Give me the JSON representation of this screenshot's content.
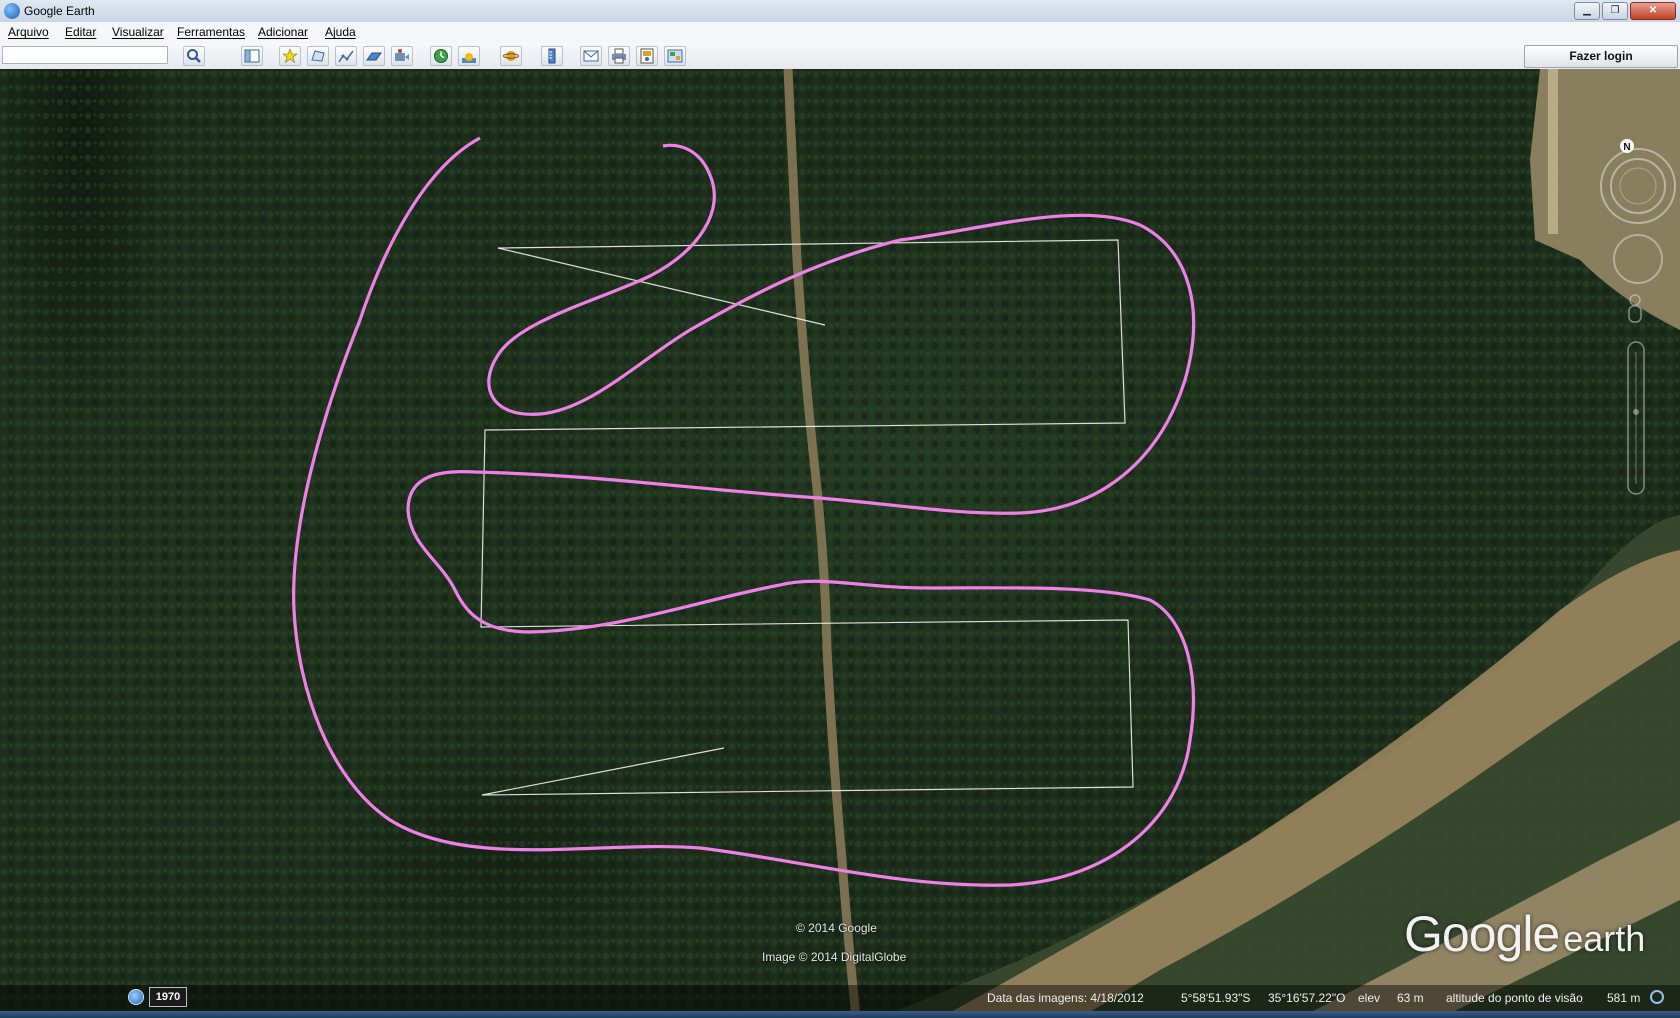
{
  "window": {
    "title": "Google Earth",
    "min_label": "▁",
    "max_label": "❐",
    "close_label": "✕"
  },
  "menu": {
    "items": [
      "Arquivo",
      "Editar",
      "Visualizar",
      "Ferramentas",
      "Adicionar",
      "Ajuda"
    ]
  },
  "toolbar": {
    "search_value": "",
    "login_label": "Fazer login",
    "icons": [
      "search-icon",
      "sidebar-toggle-icon",
      "placemark-icon",
      "polygon-icon",
      "path-icon",
      "image-overlay-icon",
      "record-tour-icon",
      "historical-imagery-icon",
      "sunlight-icon",
      "planets-icon",
      "ruler-icon",
      "email-icon",
      "print-icon",
      "save-image-icon",
      "view-in-maps-icon"
    ]
  },
  "map": {
    "copyright": "© 2014 Google",
    "imagery_credit": "Image © 2014 DigitalGlobe",
    "logo_google": "Google",
    "logo_earth": "earth",
    "compass_north": "N",
    "path_color": "#f080e8",
    "grid_color": "#ffffff"
  },
  "status": {
    "year": "1970",
    "imagery_date": "Data das imagens: 4/18/2012",
    "latitude": "5°58'51.93\"S",
    "longitude": "35°16'57.22\"O",
    "elev_label": "elev",
    "elev_value": "63 m",
    "eye_alt_label": "altitude do ponto de visão",
    "eye_alt_value": "581 m"
  }
}
